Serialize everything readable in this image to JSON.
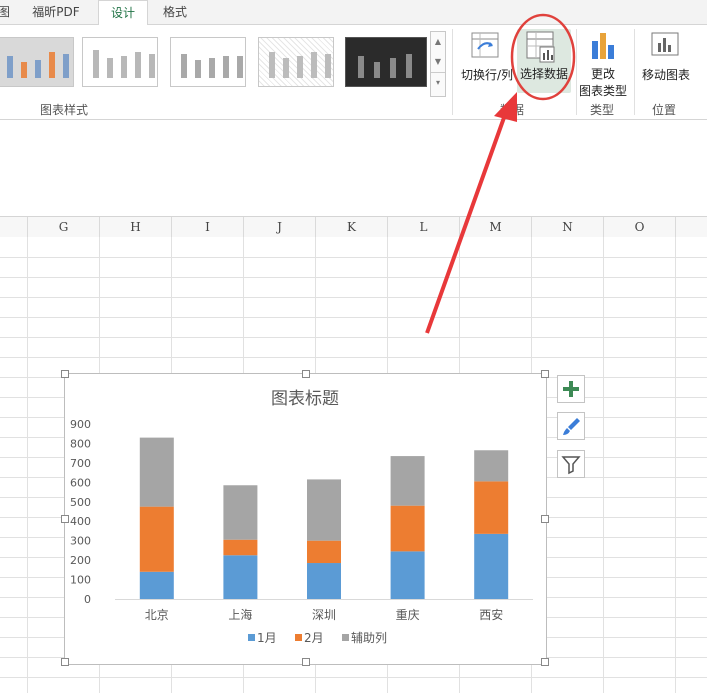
{
  "tabs": [
    {
      "label": "图",
      "active": false
    },
    {
      "label": "福昕PDF",
      "active": false
    },
    {
      "label": "设计",
      "active": true
    },
    {
      "label": "格式",
      "active": false
    }
  ],
  "ribbon": {
    "styles_group_label": "图表样式",
    "switch_rowcol_label": "切换行/列",
    "select_data_label": "选择数据",
    "data_group_label": "数据",
    "change_type_label_1": "更改",
    "change_type_label_2": "图表类型",
    "type_group_label": "类型",
    "move_chart_label": "移动图表",
    "location_group_label": "位置"
  },
  "columns": [
    "G",
    "H",
    "I",
    "J",
    "K",
    "L",
    "M",
    "N",
    "O"
  ],
  "accent_color": "#217346",
  "highlight_circle_color": "#e0413c",
  "arrow_color": "#e8383a",
  "chart_data": {
    "type": "bar",
    "stacked": true,
    "title": "图表标题",
    "categories": [
      "北京",
      "上海",
      "深圳",
      "重庆",
      "西安"
    ],
    "series": [
      {
        "name": "1月",
        "values": [
          140,
          225,
          185,
          245,
          335
        ],
        "color": "#5b9bd5"
      },
      {
        "name": "2月",
        "values": [
          335,
          80,
          115,
          235,
          270
        ],
        "color": "#ed7d31"
      },
      {
        "name": "辅助列",
        "values": [
          355,
          280,
          315,
          255,
          160
        ],
        "color": "#a5a5a5"
      }
    ],
    "ylim": [
      0,
      900
    ],
    "yticks": [
      "0",
      "100",
      "200",
      "300",
      "400",
      "500",
      "600",
      "700",
      "800",
      "900"
    ],
    "legend_position": "bottom",
    "grid": false
  }
}
